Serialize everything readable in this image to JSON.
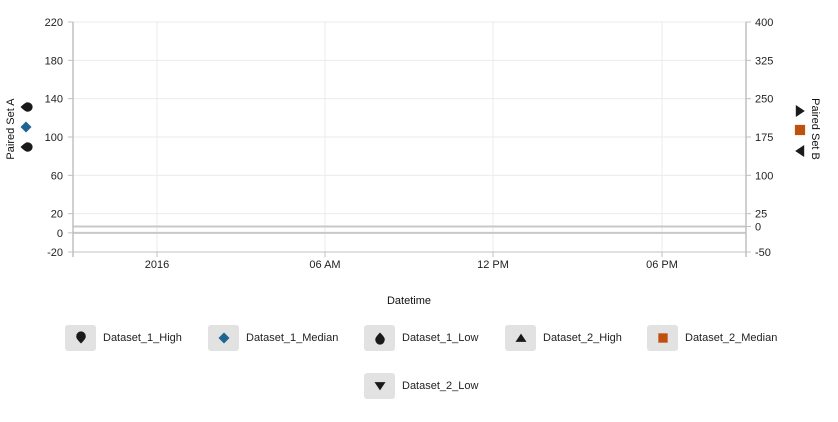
{
  "chart_data": {
    "type": "line",
    "x_axis": {
      "title": "Datetime",
      "tick_labels": [
        "2016",
        "06 AM",
        "12 PM",
        "06 PM"
      ]
    },
    "y_axis_left": {
      "title": "Paired Set A",
      "range": [
        -20,
        220
      ],
      "tick_labels": [
        "220",
        "180",
        "140",
        "100",
        "60",
        "20",
        "0",
        "-20"
      ]
    },
    "y_axis_right": {
      "title": "Paired Set B",
      "range": [
        -50,
        400
      ],
      "tick_labels": [
        "400",
        "325",
        "250",
        "175",
        "100",
        "25",
        "0",
        "-50"
      ]
    },
    "grid": true,
    "series": [
      {
        "name": "Dataset_1_High",
        "axis": "left",
        "marker": "pin-down",
        "color": "#1a1a1a"
      },
      {
        "name": "Dataset_1_Median",
        "axis": "left",
        "marker": "diamond",
        "color": "#1f6391"
      },
      {
        "name": "Dataset_1_Low",
        "axis": "left",
        "marker": "pin-up",
        "color": "#1a1a1a"
      },
      {
        "name": "Dataset_2_High",
        "axis": "right",
        "marker": "triangle-up",
        "color": "#1a1a1a"
      },
      {
        "name": "Dataset_2_Median",
        "axis": "right",
        "marker": "square",
        "color": "#c0500e"
      },
      {
        "name": "Dataset_2_Low",
        "axis": "right",
        "marker": "triangle-down",
        "color": "#1a1a1a"
      }
    ],
    "legend_placement": "bottom"
  }
}
